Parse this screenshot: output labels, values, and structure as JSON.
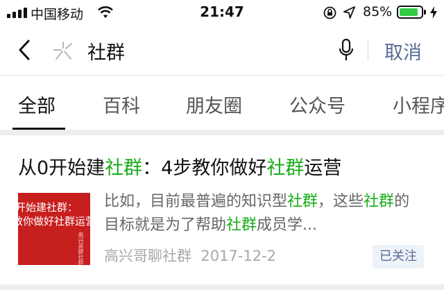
{
  "status_bar": {
    "carrier": "中国移动",
    "time": "21:47",
    "battery_percent": "85%",
    "battery_level": 0.85,
    "battery_color": "#33cc44",
    "icons": [
      "signal-icon",
      "wifi-icon",
      "orientation-lock-icon",
      "location-icon",
      "battery-icon",
      "charging-icon"
    ]
  },
  "search": {
    "query": "社群",
    "cancel_label": "取消",
    "icons": [
      "back-arrow-icon",
      "search-logo-icon",
      "microphone-icon"
    ]
  },
  "tabs": [
    {
      "label": "全部",
      "active": true
    },
    {
      "label": "百科",
      "active": false
    },
    {
      "label": "朋友圈",
      "active": false
    },
    {
      "label": "公众号",
      "active": false
    },
    {
      "label": "小程序",
      "active": false
    }
  ],
  "result": {
    "title_parts": [
      "从0开始建",
      "社群",
      "：4步教你做好",
      "社群",
      "运营"
    ],
    "thumbnail_text": {
      "line1": "开始建社群：",
      "line2": "教你做好社群运营",
      "caption": "高兴哥聊社群"
    },
    "snippet_parts": [
      "比如，目前最普遍的知识型",
      "社群",
      "，这些",
      "社群",
      "的目标就是为了帮助",
      "社群",
      "成员学..."
    ],
    "source": "高兴哥聊社群",
    "date": "2017-12-2",
    "follow_badge": "已关注"
  },
  "colors": {
    "highlight": "#1aad19",
    "link": "#576b95",
    "thumbnail_bg": "#c71e1e"
  }
}
